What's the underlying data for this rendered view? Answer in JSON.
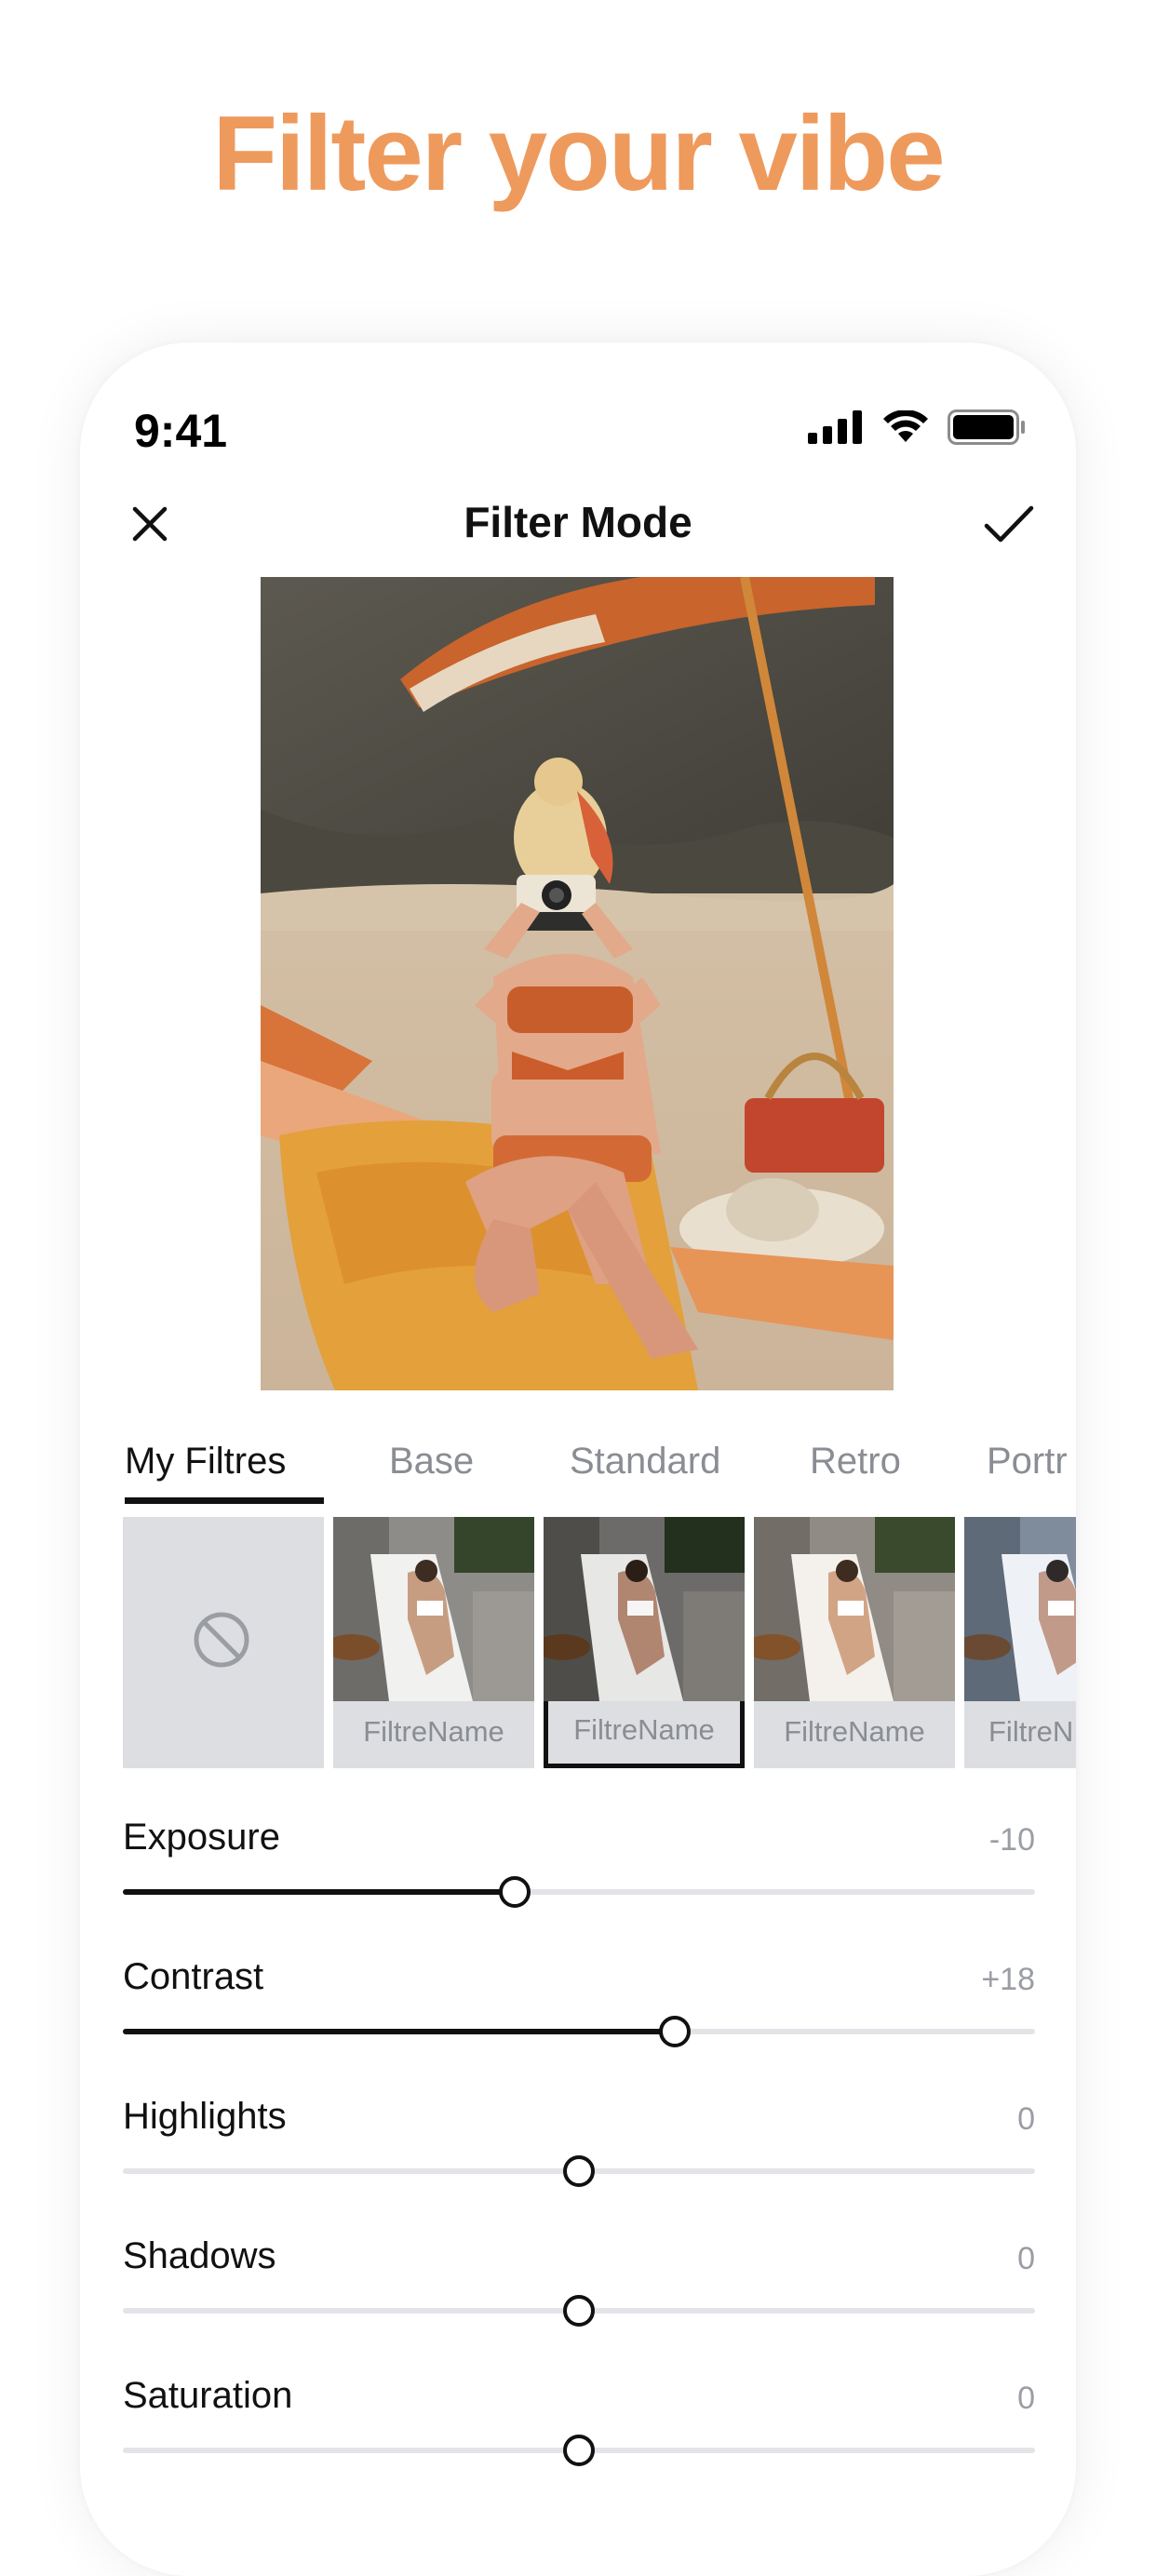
{
  "headline": "Filter your vibe",
  "colors": {
    "accent": "#EE9A5C",
    "text": "#111111",
    "muted": "#8A8D93",
    "track": "#E3E4E7"
  },
  "status_bar": {
    "time": "9:41",
    "icons": [
      "signal-icon",
      "wifi-icon",
      "battery-icon"
    ]
  },
  "nav": {
    "title": "Filter Mode",
    "close_icon": "close-icon",
    "done_icon": "checkmark-icon"
  },
  "tabs": [
    {
      "label": "My Filtres",
      "active": true
    },
    {
      "label": "Base",
      "active": false
    },
    {
      "label": "Standard",
      "active": false
    },
    {
      "label": "Retro",
      "active": false
    },
    {
      "label": "Portr",
      "active": false
    }
  ],
  "filters": [
    {
      "label": "",
      "icon": "no-filter-icon"
    },
    {
      "label": "FiltreName"
    },
    {
      "label": "FiltreName",
      "selected": true
    },
    {
      "label": "FiltreName"
    },
    {
      "label": "FiltreN"
    }
  ],
  "adjustments": [
    {
      "label": "Exposure",
      "value": "-10",
      "level": -0.14
    },
    {
      "label": "Contrast",
      "value": "+18",
      "level": 0.21
    },
    {
      "label": "Highlights",
      "value": "0",
      "level": 0
    },
    {
      "label": "Shadows",
      "value": "0",
      "level": 0
    },
    {
      "label": "Saturation",
      "value": "0",
      "level": 0
    }
  ]
}
